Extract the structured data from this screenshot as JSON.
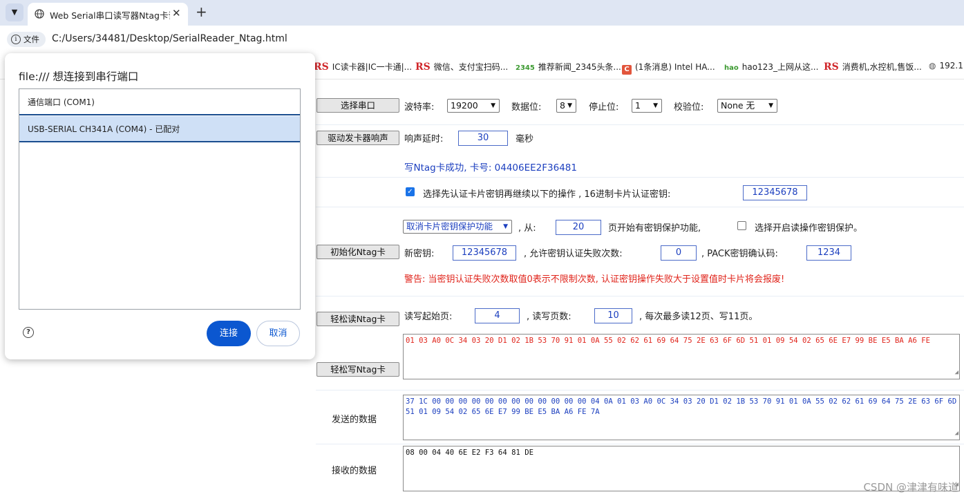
{
  "browser": {
    "tab_title": "Web Serial串口读写器Ntag卡读写",
    "new_tab": "+",
    "address_chip": "文件",
    "url": "C:/Users/34481/Desktop/SerialReader_Ntag.html",
    "bookmarks": [
      {
        "icon": "RS",
        "label": "IC读卡器|IC一卡通|..."
      },
      {
        "icon": "RS",
        "label": "微信、支付宝扫码..."
      },
      {
        "icon": "2345",
        "label": "推荐新闻_2345头条..."
      },
      {
        "icon": "C",
        "label": "(1条消息) Intel HA..."
      },
      {
        "icon": "hao",
        "label": "hao123_上网从这..."
      },
      {
        "icon": "RS",
        "label": "消费机,水控机,售饭..."
      },
      {
        "icon": "globe",
        "label": "192.1"
      }
    ]
  },
  "dialog": {
    "title": "file:/// 想连接到串行端口",
    "ports": [
      "通信端口 (COM1)",
      "USB-SERIAL CH341A (COM4) - 已配对"
    ],
    "help": "?",
    "connect": "连接",
    "cancel": "取消"
  },
  "serial": {
    "select_port": "选择串口",
    "baud_label": "波特率:",
    "baud": "19200",
    "databits_label": "数据位:",
    "databits": "8",
    "stopbits_label": "停止位:",
    "stopbits": "1",
    "parity_label": "校验位:",
    "parity": "None 无"
  },
  "beep": {
    "button": "驱动发卡器响声",
    "label": "响声延时:",
    "value": "30",
    "unit": "毫秒"
  },
  "status": {
    "message": "写Ntag卡成功, 卡号: 04406EE2F36481"
  },
  "auth": {
    "checked": "✓",
    "label": "选择先认证卡片密钥再继续以下的操作 , 16进制卡片认证密钥:",
    "key": "12345678"
  },
  "protect": {
    "mode": "取消卡片密钥保护功能",
    "from_label": ", 从:",
    "start_page": "20",
    "page_label": "页开始有密钥保护功能,",
    "read_protect_label": "选择开启读操作密钥保护。"
  },
  "init": {
    "button": "初始化Ntag卡",
    "newkey_label": "新密钥:",
    "newkey": "12345678",
    "fail_label": ", 允许密钥认证失败次数:",
    "fail_count": "0",
    "pack_label": ", PACK密钥确认码:",
    "pack": "1234",
    "warning": "警告: 当密钥认证失败次数取值0表示不限制次数, 认证密钥操作失败大于设置值时卡片将会报废!"
  },
  "rw": {
    "read_button": "轻松读Ntag卡",
    "start_label": "读写起始页:",
    "start": "4",
    "count_label": ", 读写页数:",
    "count": "10",
    "note": ", 每次最多读12页、写11页。",
    "write_button": "轻松写Ntag卡",
    "data": "01 03 A0 0C 34 03 20 D1 02 1B 53 70 91 01 0A 55 02 62 61 69 64 75 2E 63 6F 6D 51 01 09 54 02 65 6E E7 99 BE E5 BA A6 FE"
  },
  "send": {
    "label": "发送的数据",
    "data": "37 1C 00 00 00 00 00 00 00 00 00 00 00 00 04 0A 01 03 A0 0C 34 03 20 D1 02 1B 53 70 91 01 0A 55 02 62 61 69 64 75 2E 63 6F 6D 51 01 09 54 02 65 6E E7 99 BE E5 BA A6 FE 7A"
  },
  "recv": {
    "label": "接收的数据",
    "data": "08 00 04 40 6E E2 F3 64 81 DE"
  },
  "watermark": "CSDN @津津有味道",
  "colors": {
    "accent": "#0b57d0",
    "selected_port": "#cfe0f6",
    "status_text": "#1c3fbf",
    "warning_text": "#e0241b",
    "rw_data_text": "#e0241b",
    "send_data_text": "#1c3fbf"
  }
}
